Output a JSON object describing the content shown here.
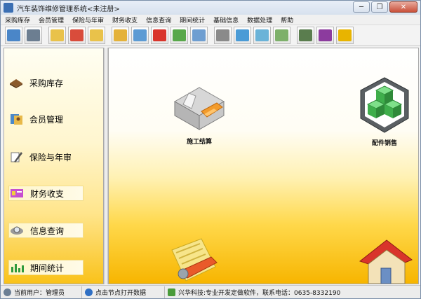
{
  "window": {
    "title": "汽车装饰维修管理系统<未注册>",
    "minimize_icon": "minimize-icon",
    "restore_icon": "restore-icon",
    "close_icon": "close-icon"
  },
  "menu": [
    {
      "label": "采购库存"
    },
    {
      "label": "会员管理"
    },
    {
      "label": "保险与年审"
    },
    {
      "label": "财务收支"
    },
    {
      "label": "信息查询"
    },
    {
      "label": "期间统计"
    },
    {
      "label": "基础信息"
    },
    {
      "label": "数据处理"
    },
    {
      "label": "帮助"
    }
  ],
  "toolbar": [
    {
      "icon": "computer-icon",
      "color": "#4a86c8"
    },
    {
      "icon": "printer-icon",
      "color": "#6c7e91"
    },
    {
      "icon": "folder-icon",
      "color": "#e9c24a"
    },
    {
      "icon": "transfer-icon",
      "color": "#d94c3b"
    },
    {
      "icon": "folder-icon",
      "color": "#e9c24a"
    },
    {
      "icon": "open-folder-icon",
      "color": "#e4b23a"
    },
    {
      "icon": "edit-document-icon",
      "color": "#5c9bd4"
    },
    {
      "icon": "umbrella-icon",
      "color": "#d9342b"
    },
    {
      "icon": "notebook-icon",
      "color": "#58a84a"
    },
    {
      "icon": "document-search-icon",
      "color": "#6e9ed1"
    },
    {
      "icon": "search-icon",
      "color": "#8a8a8a"
    },
    {
      "icon": "bell-icon",
      "color": "#4a9bd6"
    },
    {
      "icon": "note-icon",
      "color": "#6ab3d8"
    },
    {
      "icon": "picture-icon",
      "color": "#7db06a"
    },
    {
      "icon": "pda-icon",
      "color": "#5a7d4e"
    },
    {
      "icon": "help-book-icon",
      "color": "#8c3b9e"
    },
    {
      "icon": "exit-runner-icon",
      "color": "#e8b400"
    }
  ],
  "nav": [
    {
      "label": "采购库存",
      "icon": "purchase-stock-icon",
      "color": "#8b5a2b"
    },
    {
      "label": "会员管理",
      "icon": "member-icon",
      "color": "#4b89c9"
    },
    {
      "label": "保险与年审",
      "icon": "insurance-pen-icon",
      "color": "#5a5a5a"
    },
    {
      "label": "财务收支",
      "icon": "finance-icon",
      "color": "#a84bb0"
    },
    {
      "label": "信息查询",
      "icon": "magnifier-icon",
      "color": "#707070"
    },
    {
      "label": "期间统计",
      "icon": "bar-chart-icon",
      "color": "#2f9a3c"
    }
  ],
  "modules": [
    {
      "label": "施工结算",
      "icon": "settlement-drawer-icon"
    },
    {
      "label": "配件销售",
      "icon": "parts-sales-cube-icon"
    }
  ],
  "status": {
    "user": "当前用户：管理员",
    "hint": "点击节点打开数据",
    "company": "兴华科技:专业开发定做软件，联系电话：0635-8332190"
  }
}
